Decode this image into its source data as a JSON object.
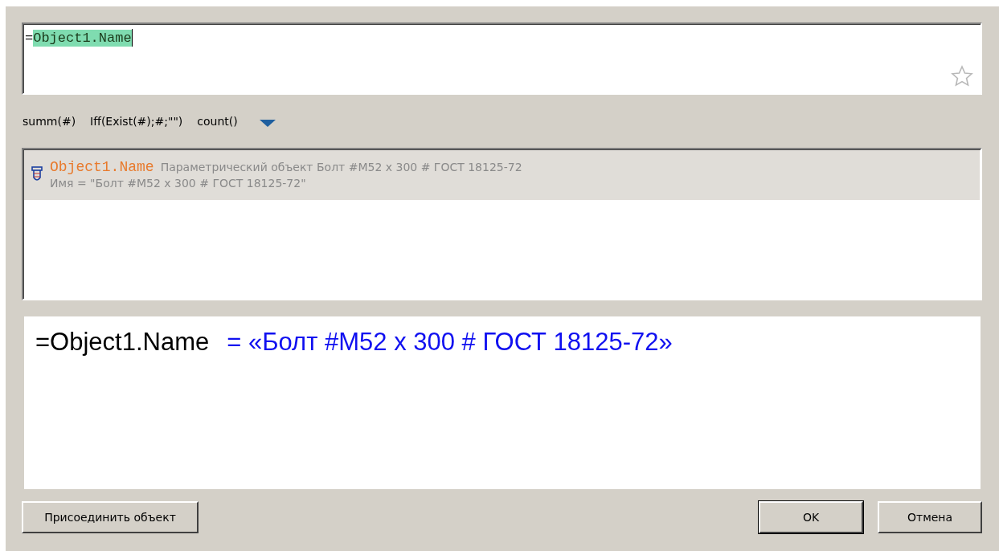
{
  "formula": {
    "prefix": "=",
    "highlighted": "Object1.Name",
    "favorite": false
  },
  "shortcuts": [
    {
      "label": "summ(#)"
    },
    {
      "label": "Iff(Exist(#);#;\"\")"
    },
    {
      "label": "count()"
    }
  ],
  "results": [
    {
      "name": "Object1.Name",
      "description": "Параметрический объект Болт #M52 x 300 # ГОСТ 18125-72",
      "value": "Имя = \"Болт #M52 x 300 # ГОСТ 18125-72\"",
      "selected": true
    }
  ],
  "preview": {
    "expression": "=Object1.Name",
    "result": "= «Болт #M52 x 300 # ГОСТ 18125-72»"
  },
  "buttons": [
    {
      "label": "Присоединить объект",
      "kind": "left",
      "default": false
    },
    {
      "label": "OK",
      "kind": "right",
      "default": true
    },
    {
      "label": "Отмена",
      "kind": "right",
      "default": false
    }
  ]
}
